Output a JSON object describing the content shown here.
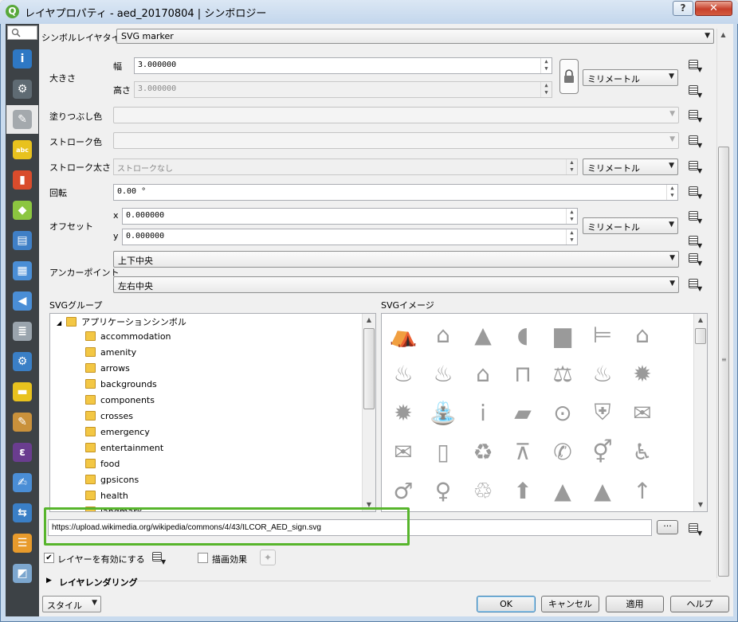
{
  "window": {
    "title": "レイヤプロパティ - aed_20170804 | シンボロジー",
    "app_icon": "Q",
    "help_label": "?",
    "close_label": "✕"
  },
  "nav": {
    "items": [
      {
        "icon": "info-icon",
        "glyph": "i",
        "color": "#2e78c4"
      },
      {
        "icon": "source-icon",
        "glyph": "⚙",
        "color": "#5f6b73"
      },
      {
        "icon": "symbology-icon",
        "glyph": "✎",
        "color": "#a4a9ad",
        "selected": true
      },
      {
        "icon": "labels-icon",
        "glyph": "abc",
        "color": "#e8c21e"
      },
      {
        "icon": "diagrams-icon",
        "glyph": "▮",
        "color": "#d94c2c"
      },
      {
        "icon": "3d-view-icon",
        "glyph": "◆",
        "color": "#8cc640"
      },
      {
        "icon": "fields-icon",
        "glyph": "▤",
        "color": "#3f7fc6"
      },
      {
        "icon": "attributes-form-icon",
        "glyph": "▦",
        "color": "#4a8ed6"
      },
      {
        "icon": "joins-icon",
        "glyph": "◀",
        "color": "#4a8ed6"
      },
      {
        "icon": "auxiliary-storage-icon",
        "glyph": "≣",
        "color": "#9aa4ad"
      },
      {
        "icon": "actions-icon",
        "glyph": "⚙",
        "color": "#3a7fc6"
      },
      {
        "icon": "display-icon",
        "glyph": "▬",
        "color": "#e8c21e"
      },
      {
        "icon": "rendering-icon",
        "glyph": "✎",
        "color": "#c9913b"
      },
      {
        "icon": "variables-icon",
        "glyph": "ε",
        "color": "#6a3d8f"
      },
      {
        "icon": "metadata-icon",
        "glyph": "✍",
        "color": "#4a8ed6"
      },
      {
        "icon": "dependencies-icon",
        "glyph": "⇆",
        "color": "#3a7fc6"
      },
      {
        "icon": "legend-icon",
        "glyph": "☰",
        "color": "#e89b2c"
      },
      {
        "icon": "qgis-server-icon",
        "glyph": "◩",
        "color": "#7da7cf"
      }
    ]
  },
  "symbol_layer": {
    "type_label": "シンボルレイヤタイプ",
    "type_value": "SVG marker"
  },
  "size": {
    "label": "大きさ",
    "width_label": "幅",
    "width_value": "3.000000",
    "height_label": "高さ",
    "height_value": "3.000000",
    "unit": "ミリメートル"
  },
  "fill_color": {
    "label": "塗りつぶし色"
  },
  "stroke_color": {
    "label": "ストローク色"
  },
  "stroke_width": {
    "label": "ストローク太さ",
    "value": "ストロークなし",
    "unit": "ミリメートル"
  },
  "rotation": {
    "label": "回転",
    "value": "0.00 °"
  },
  "offset": {
    "label": "オフセット",
    "x_label": "x",
    "x_value": "0.000000",
    "y_label": "y",
    "y_value": "0.000000",
    "unit": "ミリメートル"
  },
  "anchor": {
    "label": "アンカーポイント",
    "vertical": "上下中央",
    "horizontal": "左右中央"
  },
  "svg_groups": {
    "label": "SVGグループ",
    "root": "アプリケーションシンボル",
    "folders": [
      "accommodation",
      "amenity",
      "arrows",
      "backgrounds",
      "components",
      "crosses",
      "emergency",
      "entertainment",
      "food",
      "gpsicons",
      "health",
      "landmark"
    ]
  },
  "svg_images": {
    "label": "SVGイメージ",
    "icons": [
      "camping",
      "bed-and-breakfast",
      "tent",
      "caravan",
      "hotel",
      "hostel",
      "house",
      "fire-station",
      "fire-ruin",
      "chalet",
      "bench",
      "justice",
      "fire",
      "fire-department",
      "fire-badge",
      "fountain",
      "information",
      "library",
      "police-handcuffs",
      "police-badge",
      "post-box",
      "mail",
      "elevator",
      "recycling",
      "survey-point",
      "telephone",
      "toilets",
      "wheelchair-wc",
      "toilets-men",
      "toilets-women",
      "waste-basket",
      "arrow-up",
      "north-arrow",
      "north-arrow-2",
      "north-arrow-3"
    ]
  },
  "svg_path": "https://upload.wikimedia.org/wikipedia/commons/4/43/ILCOR_AED_sign.svg",
  "browse_label": "···",
  "enable_layer": {
    "label": "レイヤーを有効にする",
    "checked": "✔"
  },
  "draw_effects": {
    "label": "描画効果"
  },
  "layer_rendering": {
    "label": "レイヤレンダリング"
  },
  "footer": {
    "style_label": "スタイル",
    "ok_label": "OK",
    "cancel_label": "キャンセル",
    "apply_label": "適用",
    "help_label": "ヘルプ"
  },
  "colors": {
    "highlight": "#57b52c",
    "nav_bg": "#3d4246"
  }
}
